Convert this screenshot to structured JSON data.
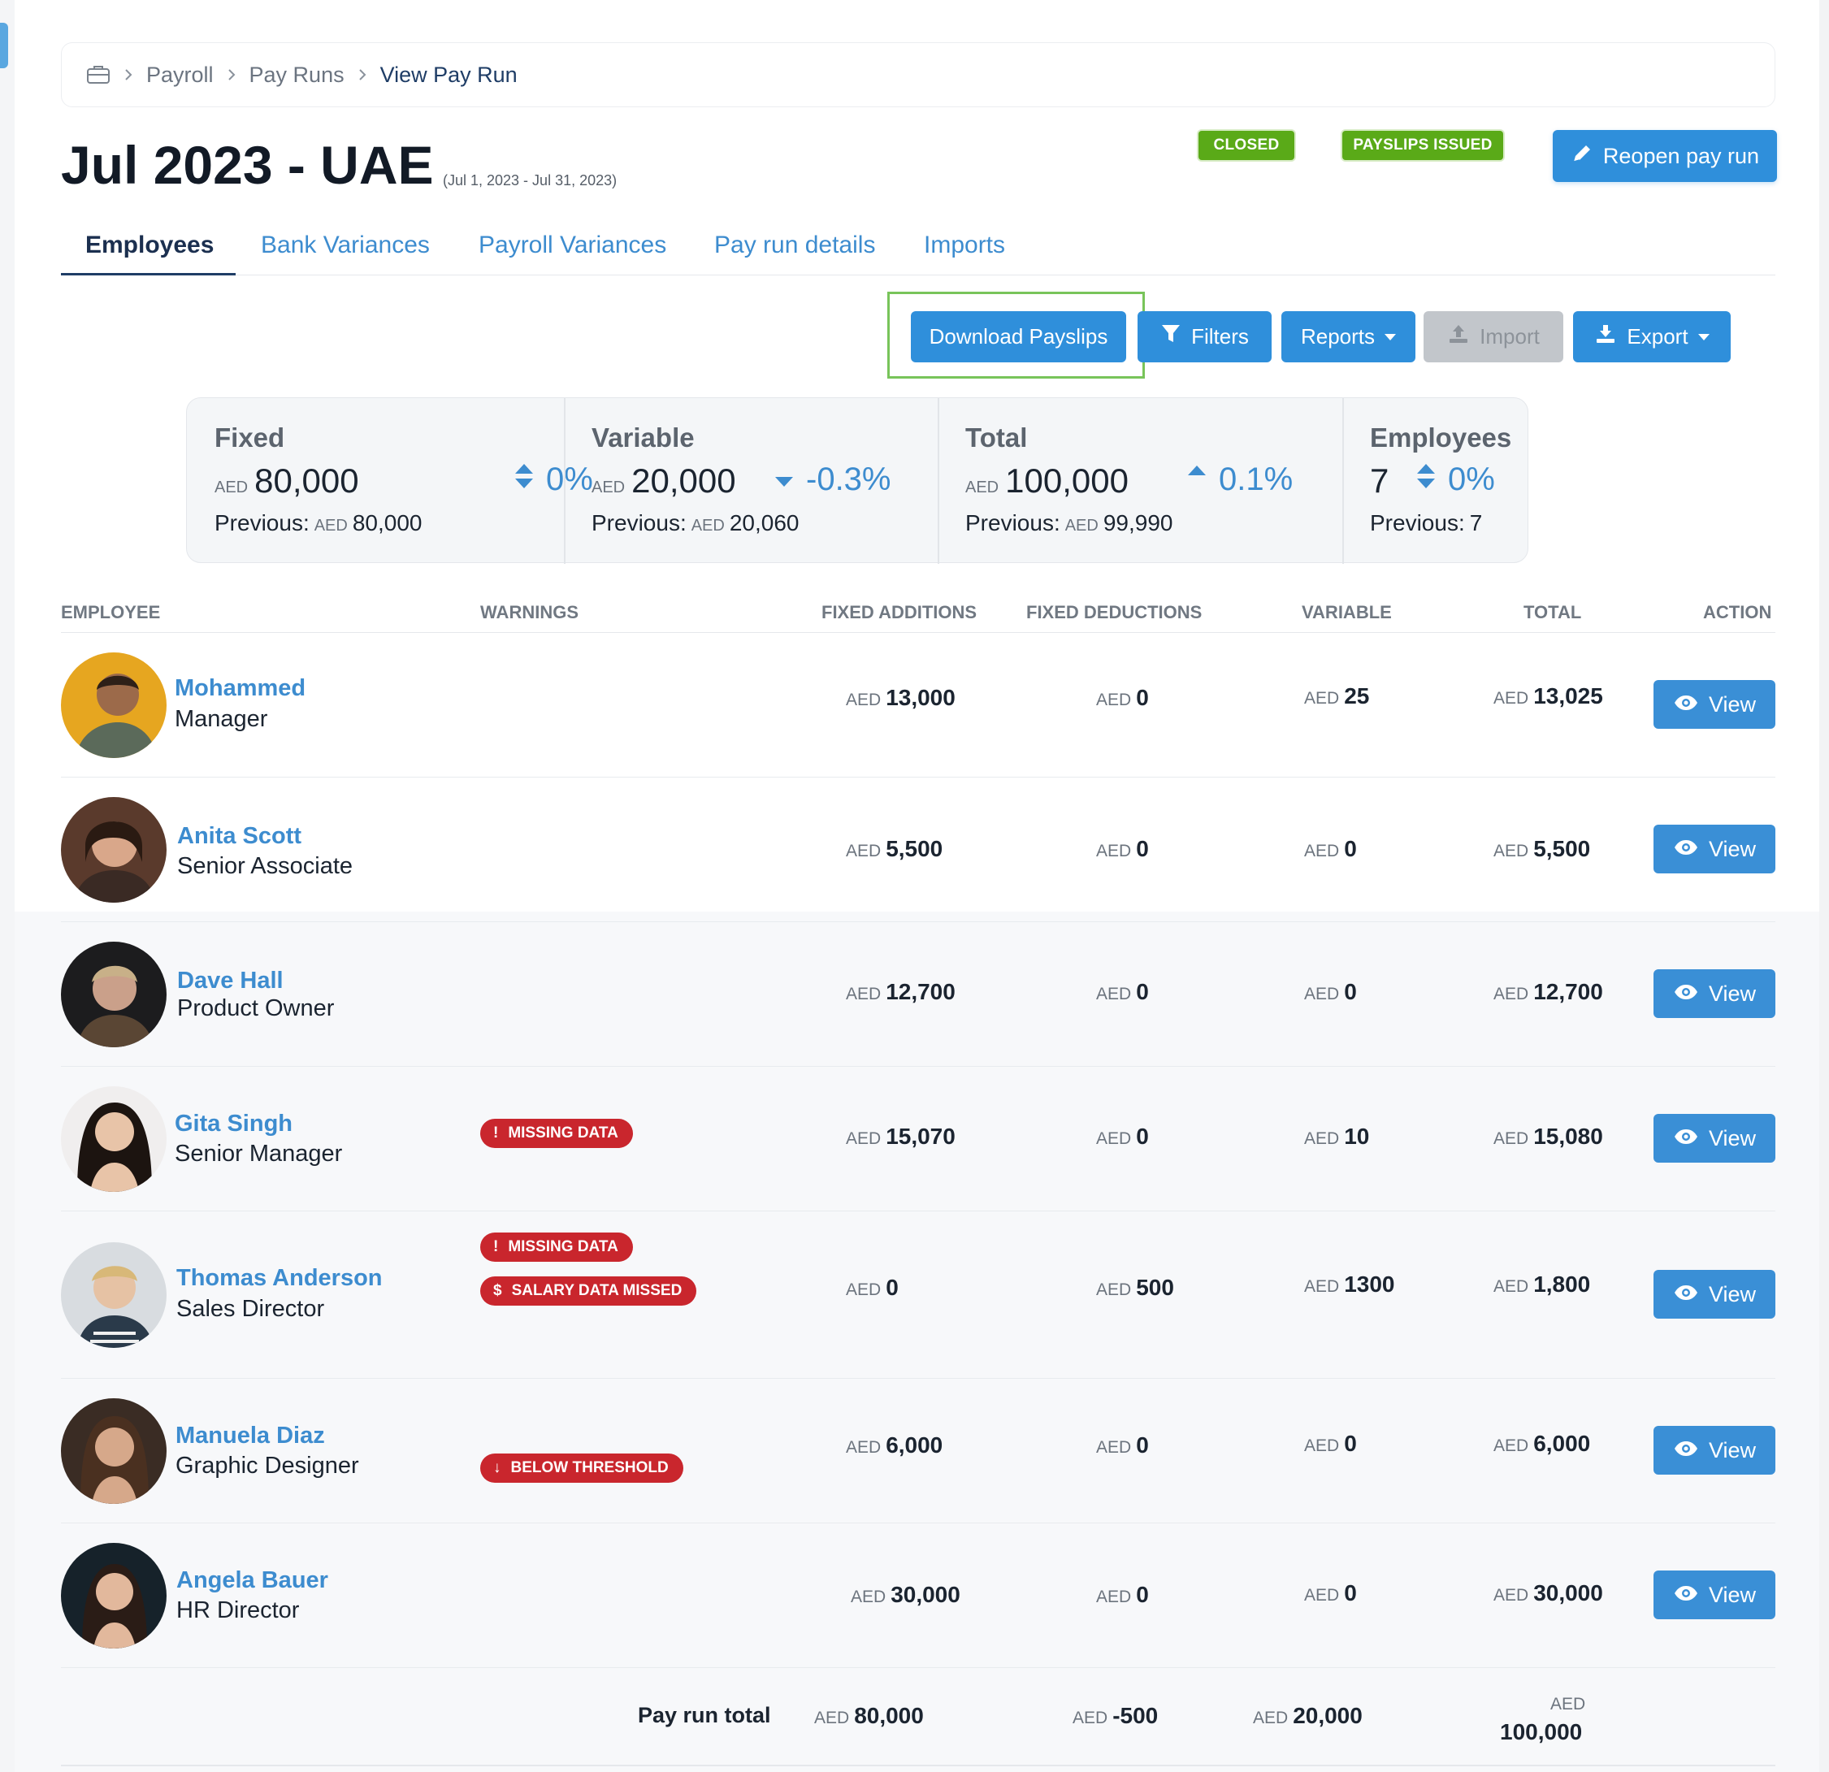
{
  "breadcrumb": {
    "items": [
      "Payroll",
      "Pay Runs"
    ],
    "current": "View Pay Run"
  },
  "header": {
    "title": "Jul 2023 - UAE",
    "date_range": "(Jul 1, 2023 - Jul 31, 2023)",
    "badges": {
      "closed": "CLOSED",
      "payslips_issued": "PAYSLIPS ISSUED"
    },
    "reopen_label": "Reopen pay run"
  },
  "tabs": [
    "Employees",
    "Bank Variances",
    "Payroll Variances",
    "Pay run details",
    "Imports"
  ],
  "toolbar": {
    "download": "Download Payslips",
    "filters": "Filters",
    "reports": "Reports",
    "import": "Import",
    "export": "Export"
  },
  "stats": {
    "previous_label": "Previous:",
    "fixed": {
      "label": "Fixed",
      "currency": "AED",
      "value": "80,000",
      "change": "0%",
      "prev_currency": "AED",
      "prev": "80,000"
    },
    "variable": {
      "label": "Variable",
      "currency": "AED",
      "value": "20,000",
      "change": "-0.3%",
      "prev_currency": "AED",
      "prev": "20,060"
    },
    "total": {
      "label": "Total",
      "currency": "AED",
      "value": "100,000",
      "change": "0.1%",
      "prev_currency": "AED",
      "prev": "99,990"
    },
    "employees": {
      "label": "Employees",
      "value": "7",
      "change": "0%",
      "prev": "7"
    }
  },
  "table": {
    "headers": {
      "employee": "EMPLOYEE",
      "warnings": "WARNINGS",
      "fixed_additions": "FIXED ADDITIONS",
      "fixed_deductions": "FIXED DEDUCTIONS",
      "variable": "VARIABLE",
      "total": "TOTAL",
      "action": "ACTION"
    },
    "currency": "AED",
    "view_label": "View",
    "rows": [
      {
        "name": "Mohammed",
        "role": "Manager",
        "fixed_additions": "13,000",
        "fixed_deductions": "0",
        "variable": "25",
        "total": "13,025",
        "warnings": []
      },
      {
        "name": "Anita Scott",
        "role": "Senior Associate",
        "fixed_additions": "5,500",
        "fixed_deductions": "0",
        "variable": "0",
        "total": "5,500",
        "warnings": []
      },
      {
        "name": "Dave Hall",
        "role": "Product Owner",
        "fixed_additions": "12,700",
        "fixed_deductions": "0",
        "variable": "0",
        "total": "12,700",
        "warnings": []
      },
      {
        "name": "Gita Singh",
        "role": "Senior Manager",
        "fixed_additions": "15,070",
        "fixed_deductions": "0",
        "variable": "10",
        "total": "15,080",
        "warnings": [
          "MISSING DATA"
        ]
      },
      {
        "name": "Thomas Anderson",
        "role": "Sales Director",
        "fixed_additions": "0",
        "fixed_deductions": "500",
        "variable": "1300",
        "total": "1,800",
        "warnings": [
          "MISSING DATA",
          "SALARY DATA MISSED"
        ]
      },
      {
        "name": "Manuela Diaz",
        "role": "Graphic Designer",
        "fixed_additions": "6,000",
        "fixed_deductions": "0",
        "variable": "0",
        "total": "6,000",
        "warnings": [
          "BELOW THRESHOLD"
        ]
      },
      {
        "name": "Angela Bauer",
        "role": "HR Director",
        "fixed_additions": "30,000",
        "fixed_deductions": "0",
        "variable": "0",
        "total": "30,000",
        "warnings": []
      }
    ],
    "footer": {
      "label": "Pay run total",
      "fixed_additions": "80,000",
      "fixed_deductions": "-500",
      "variable": "20,000",
      "total": "100,000"
    }
  },
  "colors": {
    "primary": "#2f8fdb",
    "link": "#3d8ccf",
    "success": "#5aaa18",
    "danger": "#c9262d",
    "highlight": "#78c45a"
  },
  "icons": {
    "breadcrumb_home": "briefcase-icon",
    "reopen": "pencil-icon",
    "filters": "funnel-icon",
    "import": "upload-icon",
    "export": "download-icon",
    "view": "eye-icon"
  }
}
